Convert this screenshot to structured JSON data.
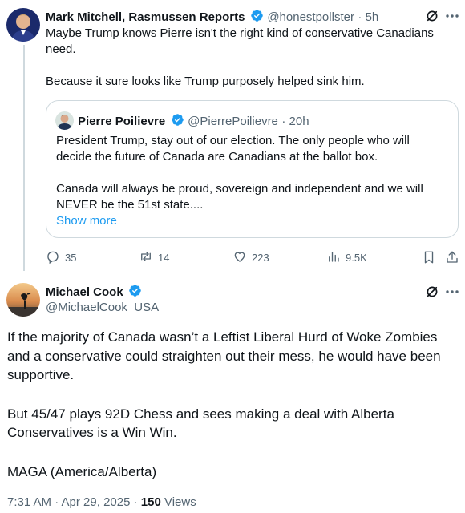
{
  "reply_tweet": {
    "author_name": "Mark Mitchell, Rasmussen Reports",
    "handle": "@honestpollster",
    "time": "· 5h",
    "text_line1": "Maybe Trump knows Pierre isn't the right kind of conservative Canadians",
    "text_line2": "need.",
    "text_line3": "Because it sure looks like Trump purposely helped sink him.",
    "quoted": {
      "author_name": "Pierre Poilievre",
      "handle": "@PierrePoilievre",
      "time": "· 20h",
      "line1": "President Trump, stay out of our election. The only people who will",
      "line2": "decide the future of Canada are Canadians at the ballot box.",
      "line3": "Canada will always be proud, sovereign and independent and we will",
      "line4": "NEVER be the 51st state....",
      "show_more": "Show more"
    },
    "actions": {
      "replies": "35",
      "reposts": "14",
      "likes": "223",
      "views": "9.5K"
    }
  },
  "main_tweet": {
    "author_name": "Michael Cook",
    "handle": "@MichaelCook_USA",
    "line1": "If the majority of Canada wasn’t a Leftist Liberal Hurd of Woke Zombies",
    "line2": "and a conservative could straighten out their mess, he would have been",
    "line3": "supportive.",
    "line4": "But 45/47 plays 92D Chess and sees making a deal with Alberta",
    "line5": "Conservatives is a Win Win.",
    "line6": "MAGA (America/Alberta)",
    "timestamp": "7:31 AM · Apr 29, 2025 · ",
    "views_count": "150",
    "views_label": " Views"
  },
  "colors": {
    "verified": "#1d9bf0",
    "text": "#0f1419",
    "secondary": "#536471",
    "link": "#1d9bf0",
    "border": "#cfd9de"
  },
  "icons": [
    "verified-badge-icon",
    "grok-icon",
    "more-icon",
    "reply-icon",
    "repost-icon",
    "like-icon",
    "views-icon",
    "bookmark-icon",
    "share-icon"
  ]
}
